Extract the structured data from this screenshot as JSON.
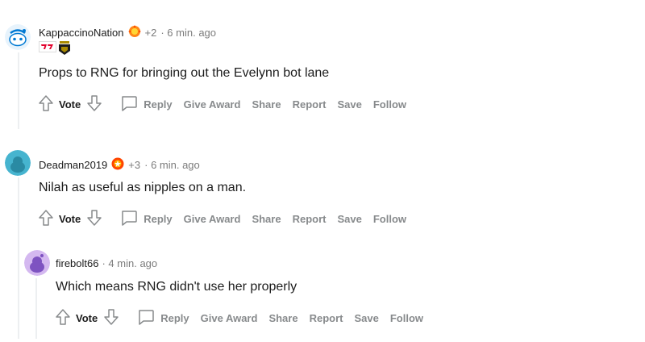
{
  "comments": [
    {
      "username": "KappaccinoNation",
      "extra": "+2",
      "time": "· 6 min. ago",
      "body": "Props to RNG for bringing out the Evelynn bot lane",
      "avatar_color": "#0079d3",
      "avatar_bg": "#e7f3fc",
      "flair_icons": [
        "t1-logo-icon",
        "gen-g-logo-icon"
      ]
    },
    {
      "username": "Deadman2019",
      "extra": "+3",
      "time": "· 6 min. ago",
      "body": "Nilah as useful as nipples on a man.",
      "avatar_color": "#24a0ed",
      "avatar_bg": "#46b4cf"
    },
    {
      "username": "firebolt66",
      "time": "· 4 min. ago",
      "body": "Which means RNG didn't use her properly",
      "avatar_color": "#7e53c1",
      "avatar_bg": "#d4b8f0"
    }
  ],
  "actions": {
    "vote": "Vote",
    "reply": "Reply",
    "give_award": "Give Award",
    "share": "Share",
    "report": "Report",
    "save": "Save",
    "follow": "Follow"
  },
  "colors": {
    "text_primary": "#1c1c1c",
    "text_meta": "#7c7c7c",
    "action_gray": "#878a8c",
    "thread_line": "#edeff1"
  }
}
